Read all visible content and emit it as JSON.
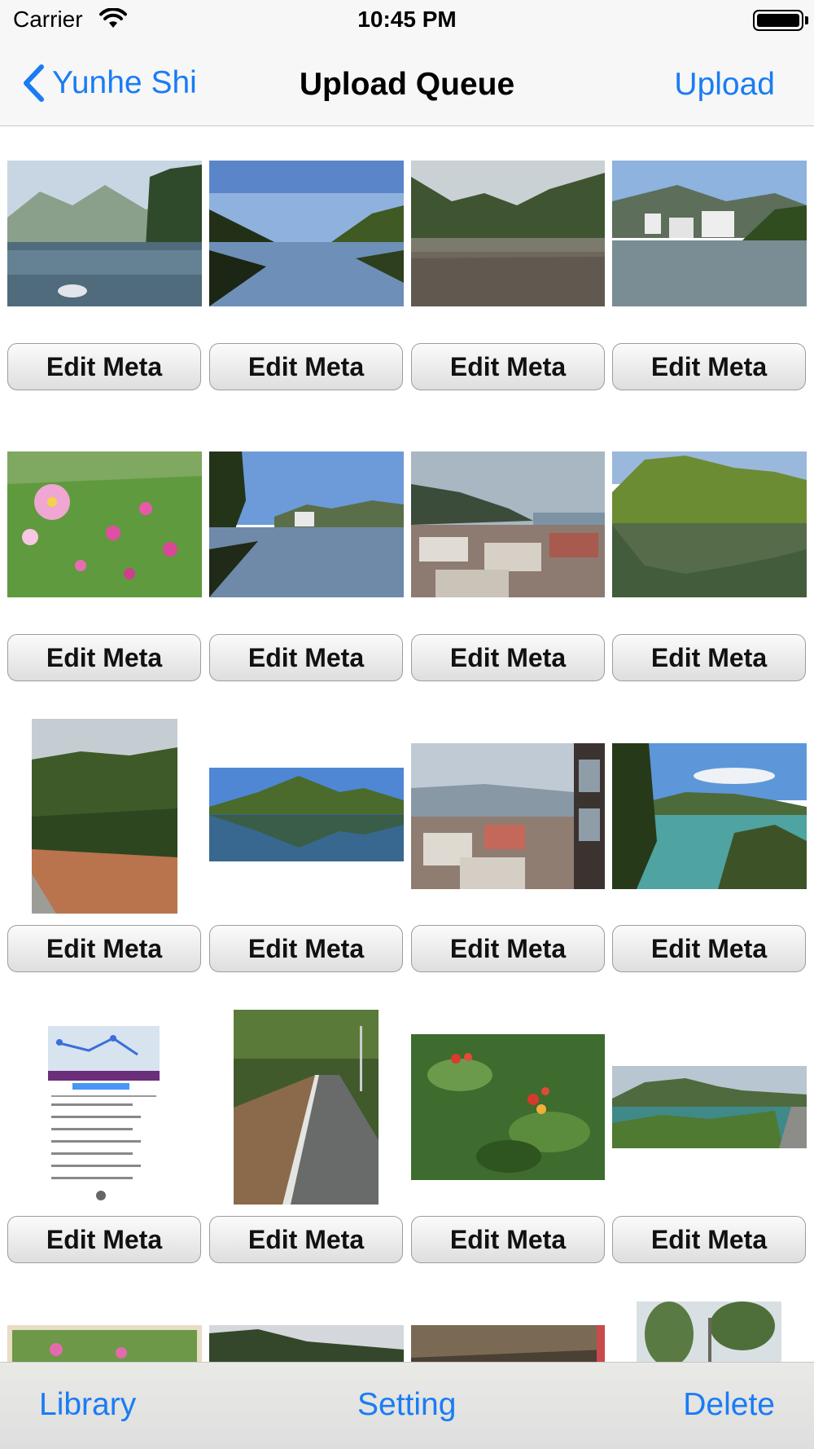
{
  "status_bar": {
    "carrier": "Carrier",
    "time": "10:45 PM"
  },
  "nav": {
    "back_label": "Yunhe Shi",
    "title": "Upload Queue",
    "upload_label": "Upload"
  },
  "grid": {
    "button_label": "Edit Meta"
  },
  "toolbar": {
    "library": "Library",
    "setting": "Setting",
    "delete": "Delete"
  },
  "colors": {
    "accent": "#1a7cf4",
    "bar_background": "#f7f7f7"
  }
}
